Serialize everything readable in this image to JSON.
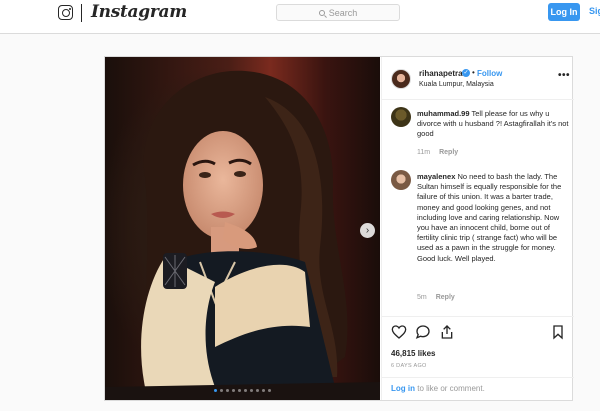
{
  "header": {
    "wordmark": "Instagram",
    "search_placeholder": "Search",
    "login_label": "Log In",
    "signup_label": "Sign Up"
  },
  "post": {
    "username": "rihanapetra",
    "verified_icon": "verified-badge-icon",
    "follow_separator": "•",
    "follow_label": "Follow",
    "location": "Kuala Lumpur, Malaysia",
    "more_label": "•••",
    "carousel": {
      "slide_count": 10,
      "active_slide": 1,
      "next_icon": "chevron-right-icon"
    },
    "comments": [
      {
        "user": "muhammad.99",
        "text": "Tell please for us why u divorce with u husband ?! Astagfirallah it's not good",
        "age": "11m",
        "reply_label": "Reply"
      },
      {
        "user": "mayalenex",
        "text": "No need to bash the lady. The Sultan himself is equally responsible for the failure of this union. It was a barter trade, money and good looking genes, and not including love and caring relationship. Now you have an innocent child, borne out of fertility clinic trip ( strange fact) who will be used as a pawn in the struggle for money. Good luck. Well played.",
        "age": "5m",
        "reply_label": "Reply"
      }
    ],
    "likes": "46,815 likes",
    "posted": "6 DAYS AGO",
    "login_link": "Log in",
    "login_suffix": " to like or comment."
  },
  "colors": {
    "accent": "#3897f0",
    "border": "#dbdbdb",
    "muted": "#999999"
  }
}
